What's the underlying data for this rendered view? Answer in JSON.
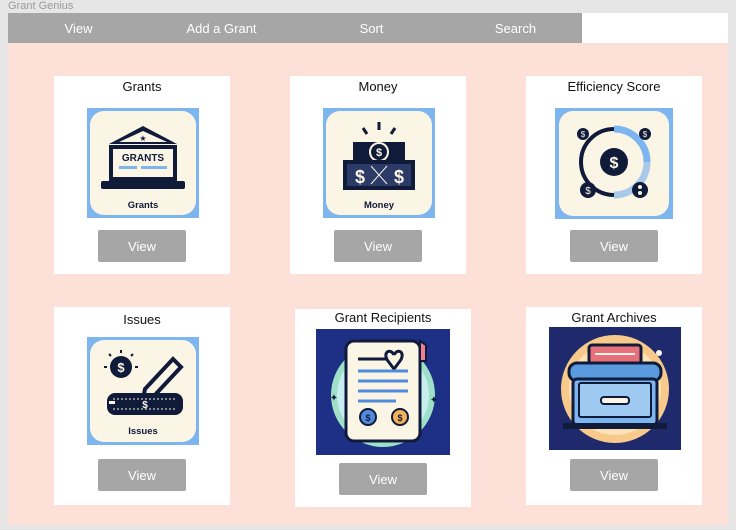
{
  "app": {
    "title": "Grant Genius"
  },
  "nav": [
    {
      "label": "View"
    },
    {
      "label": "Add a Grant"
    },
    {
      "label": "Sort"
    },
    {
      "label": "Search"
    }
  ],
  "cards": [
    {
      "title": "Grants",
      "button": "View",
      "icon": "grants-building-laptop-icon",
      "image_text": "Grants",
      "image_subtext": "GRANTS"
    },
    {
      "title": "Money",
      "button": "View",
      "icon": "money-bills-icon",
      "image_text": "Money"
    },
    {
      "title": "Efficiency Score",
      "button": "View",
      "icon": "efficiency-gauge-icon"
    },
    {
      "title": "Issues",
      "button": "View",
      "icon": "issues-pen-card-icon",
      "image_text": "Issues"
    },
    {
      "title": "Grant Recipients",
      "button": "View",
      "icon": "recipients-document-icon"
    },
    {
      "title": "Grant Archives",
      "button": "View",
      "icon": "archives-filing-cabinet-icon"
    }
  ],
  "colors": {
    "main_bg": "#fde0d7",
    "button_bg": "#a6a6a6",
    "icon_blue": "#7db6ee",
    "icon_dark": "#101b3a"
  }
}
